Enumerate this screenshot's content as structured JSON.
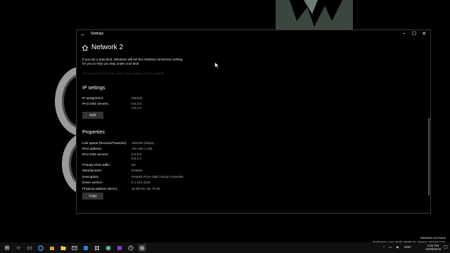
{
  "window": {
    "title": "Settings",
    "back_glyph": "←",
    "min_glyph": "–",
    "max_glyph": "☐",
    "close_glyph": "✕"
  },
  "page": {
    "title": "Network 2",
    "intro_line1": "If you set a data limit, Windows will set the metered connection setting",
    "intro_line2": "for you to help you stay under your limit.",
    "data_limit_link": "Set a data limit to help control data usage on this network"
  },
  "ip_settings": {
    "heading": "IP settings",
    "assignment_label": "IP assignment:",
    "assignment_value": "Manual",
    "dns_label": "IPv4 DNS servers:",
    "dns_value1": "8.8.8.8",
    "dns_value2": "8.8.4.4",
    "edit_button": "Edit"
  },
  "properties": {
    "heading": "Properties",
    "rows": [
      {
        "label": "Link speed (Receive/Transmit):",
        "value": "100/100 (Mbps)"
      },
      {
        "label": "IPv4 address:",
        "value": "192.168.1.245"
      },
      {
        "label": "IPv4 DNS servers:",
        "value": "8.8.8.8"
      },
      {
        "label": "",
        "value": "8.8.4.4"
      },
      {
        "label": "Primary DNS suffix:",
        "value": "lan"
      },
      {
        "label": "Manufacturer:",
        "value": "Realtek"
      },
      {
        "label": "Description:",
        "value": "Realtek PCIe GBE Family Controller"
      },
      {
        "label": "Driver version:",
        "value": "9.1.410.2015"
      },
      {
        "label": "Physical address (MAC):",
        "value": "40-8D-5C-4D-79-35"
      }
    ],
    "copy_button": "Copy"
  },
  "watermark": {
    "line1": "Windows 10 Home",
    "line2": "Evaluation copy. Build 19008.vb_release.191016-1711"
  },
  "taskbar": {
    "start_glyph": "⊞",
    "search_glyph": "○",
    "taskview_glyph": "▭",
    "tray_up": "^",
    "tray_lang": "ENG",
    "clock_time": "2:02 PM",
    "clock_date": "10/28/2019",
    "notif_glyph": "▢"
  },
  "colors": {
    "accent": "#0078d7",
    "window_bg": "#000000",
    "button_bg": "#333333"
  }
}
